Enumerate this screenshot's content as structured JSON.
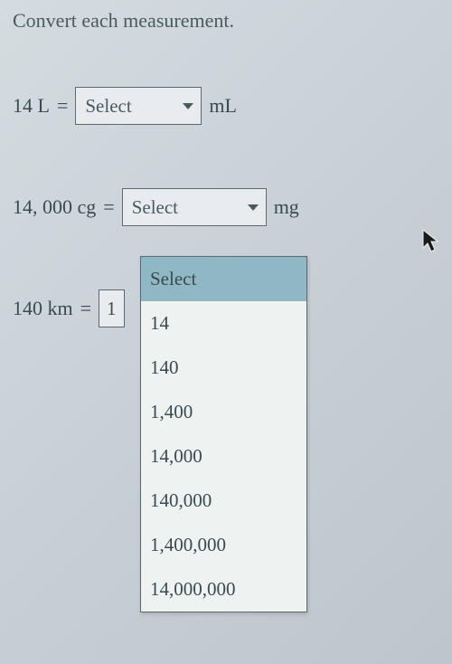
{
  "instruction": "Convert each measurement.",
  "rows": [
    {
      "lhs": "14 L",
      "eq": "=",
      "selectLabel": "Select",
      "unit": "mL"
    },
    {
      "lhs": "14, 000 cg",
      "eq": "=",
      "selectLabel": "Select",
      "unit": "mg"
    },
    {
      "lhs": "140 km",
      "eq": "=",
      "inputValue": "1",
      "unit": ""
    }
  ],
  "dropdown": {
    "options": [
      "Select",
      "14",
      "140",
      "1,400",
      "14,000",
      "140,000",
      "1,400,000",
      "14,000,000"
    ],
    "highlightedIndex": 0
  }
}
